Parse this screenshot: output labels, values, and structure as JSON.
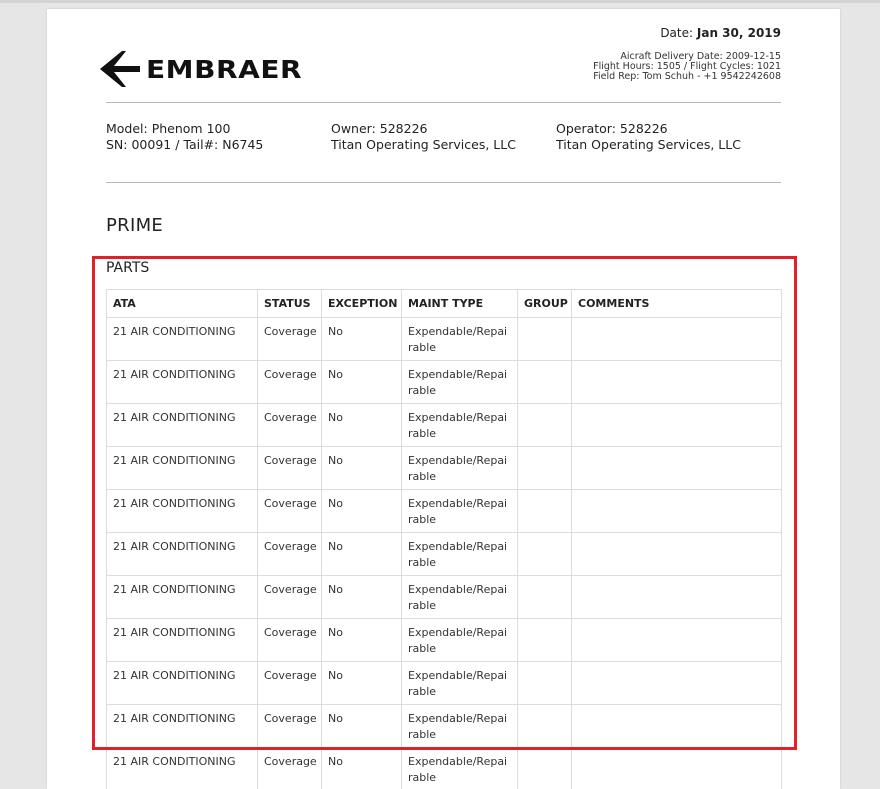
{
  "header": {
    "logo_text": "EMBRAER",
    "date_label": "Date:",
    "date_value": "Jan 30, 2019",
    "delivery_line": "Aicraft Delivery Date: 2009-12-15",
    "hours_line": "Flight Hours: 1505 / Flight Cycles: 1021",
    "rep_line": "Field Rep: Tom Schuh - +1 9542242608"
  },
  "aircraft": {
    "model": "Model: Phenom 100",
    "sn_tail": "SN: 00091 / Tail#: N6745",
    "owner_label": "Owner: 528226",
    "owner_name": "Titan Operating Services, LLC",
    "operator_label": "Operator: 528226",
    "operator_name": "Titan Operating Services, LLC"
  },
  "program": "PRIME",
  "section": "PARTS",
  "table": {
    "headers": [
      "ATA",
      "STATUS",
      "EXCEPTION",
      "MAINT TYPE",
      "GROUP",
      "COMMENTS"
    ],
    "rows": [
      [
        "21 AIR CONDITIONING",
        "Coverage",
        "No",
        "Expendable/Repairable",
        "",
        ""
      ],
      [
        "21 AIR CONDITIONING",
        "Coverage",
        "No",
        "Expendable/Repairable",
        "",
        ""
      ],
      [
        "21 AIR CONDITIONING",
        "Coverage",
        "No",
        "Expendable/Repairable",
        "",
        ""
      ],
      [
        "21 AIR CONDITIONING",
        "Coverage",
        "No",
        "Expendable/Repairable",
        "",
        ""
      ],
      [
        "21 AIR CONDITIONING",
        "Coverage",
        "No",
        "Expendable/Repairable",
        "",
        ""
      ],
      [
        "21 AIR CONDITIONING",
        "Coverage",
        "No",
        "Expendable/Repairable",
        "",
        ""
      ],
      [
        "21 AIR CONDITIONING",
        "Coverage",
        "No",
        "Expendable/Repairable",
        "",
        ""
      ],
      [
        "21 AIR CONDITIONING",
        "Coverage",
        "No",
        "Expendable/Repairable",
        "",
        ""
      ],
      [
        "21 AIR CONDITIONING",
        "Coverage",
        "No",
        "Expendable/Repairable",
        "",
        ""
      ],
      [
        "21 AIR CONDITIONING",
        "Coverage",
        "No",
        "Expendable/Repairable",
        "",
        ""
      ],
      [
        "21 AIR CONDITIONING",
        "Coverage",
        "No",
        "Expendable/Repairable",
        "",
        ""
      ]
    ]
  },
  "colors": {
    "highlight": "#e0202a",
    "divider": "#aebbc6",
    "background": "#e6e6e6"
  }
}
